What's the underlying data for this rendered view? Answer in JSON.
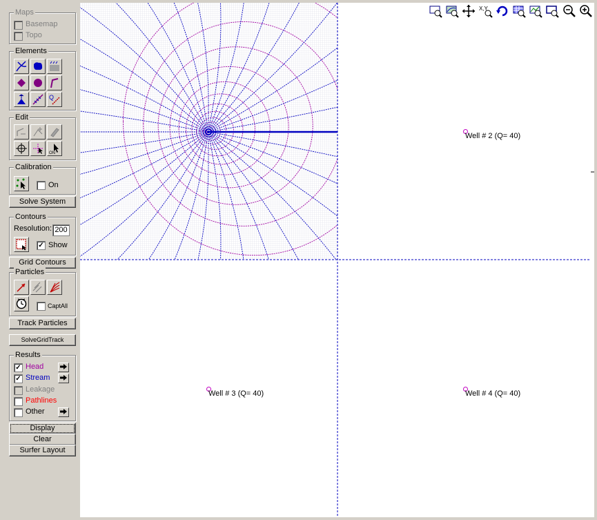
{
  "maps": {
    "title": "Maps",
    "items": [
      {
        "label": "Basemap",
        "checked": false
      },
      {
        "label": "Topo",
        "checked": false
      }
    ]
  },
  "elements": {
    "title": "Elements",
    "icons": [
      "river-icon",
      "lake-icon",
      "recharge-area-icon",
      "inhomogeneity-icon",
      "well-icon",
      "line-sink-icon",
      "spring-icon",
      "drain-icon",
      "discharge-line-icon"
    ]
  },
  "edit": {
    "title": "Edit",
    "icons": [
      "edit-line-icon",
      "add-vertex-icon",
      "delete-icon",
      "crosshair-icon",
      "move-icon",
      "pointer-icon"
    ]
  },
  "calibration": {
    "title": "Calibration",
    "on_label": "On",
    "on_checked": false
  },
  "solve_button": "Solve System",
  "contours": {
    "title": "Contours",
    "resolution_label": "Resolution:",
    "resolution_value": "200",
    "show_label": "Show",
    "show_checked": true
  },
  "grid_contours_button": "Grid Contours",
  "particles": {
    "title": "Particles",
    "capt_all_label": "CaptAll",
    "capt_all_checked": false
  },
  "track_particles_button": "Track Particles",
  "solve_grid_track_button": "SolveGridTrack",
  "results": {
    "title": "Results",
    "items": [
      {
        "label": "Head",
        "checked": true,
        "color": "#a000a0",
        "arrow": true,
        "enabled": true
      },
      {
        "label": "Stream",
        "checked": true,
        "color": "#0000c0",
        "arrow": true,
        "enabled": true
      },
      {
        "label": "Leakage",
        "checked": false,
        "color": "#808080",
        "arrow": false,
        "enabled": false
      },
      {
        "label": "Pathlines",
        "checked": false,
        "color": "#ff0000",
        "arrow": false,
        "enabled": true
      },
      {
        "label": "Other",
        "checked": false,
        "color": "#000000",
        "arrow": true,
        "enabled": true
      }
    ]
  },
  "display_button": "Display",
  "clear_button": "Clear",
  "surfer_layout_button": "Surfer Layout",
  "toolbar": {
    "icons": [
      "zoom-window-icon",
      "zoom-contour-icon",
      "pan-icon",
      "coordinates-icon",
      "refresh-icon",
      "grid-zoom-icon",
      "map-zoom-icon",
      "zoom-extent-icon",
      "zoom-out-icon",
      "zoom-in-icon"
    ]
  },
  "wells": [
    {
      "label": "Well # 2 (Q= 40)"
    },
    {
      "label": "Well # 3 (Q= 40)"
    },
    {
      "label": "Well # 4 (Q= 40)"
    }
  ],
  "colors": {
    "head_contour": "#a000a0",
    "stream_line": "#0000c0",
    "grid_line": "#0000c0"
  }
}
